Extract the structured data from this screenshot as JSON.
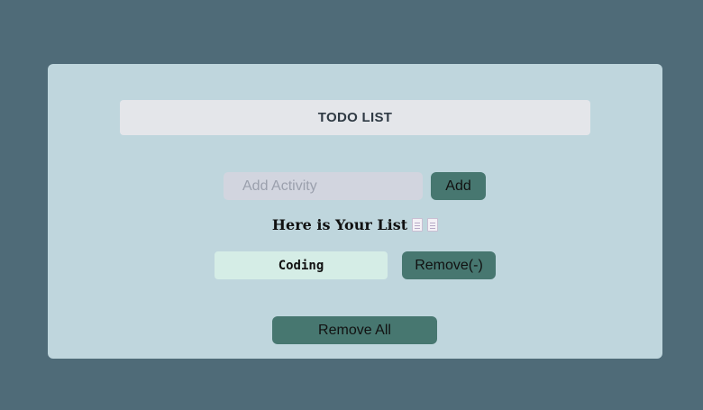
{
  "header": {
    "title": "TODO LIST"
  },
  "input": {
    "placeholder": "Add Activity",
    "value": ""
  },
  "buttons": {
    "add": "Add",
    "remove_all": "Remove All"
  },
  "list": {
    "heading": "Here is Your List",
    "heading_icons": [
      "document-icon",
      "document-icon"
    ],
    "items": [
      {
        "text": "Coding",
        "remove_label": "Remove(-)"
      }
    ]
  },
  "colors": {
    "page_background": "#4f6b78",
    "card_background": "#bfd6dd",
    "title_background": "#e4e6ea",
    "input_background": "#d2d5df",
    "button_background": "#477770",
    "item_background": "#d5ede6"
  }
}
